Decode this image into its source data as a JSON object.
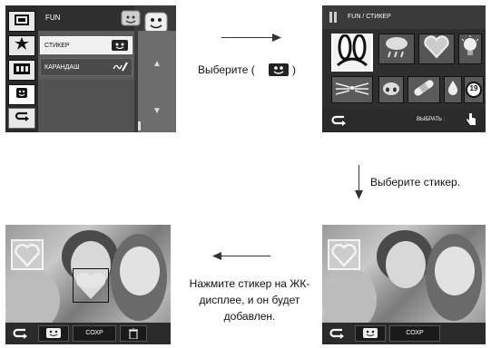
{
  "screen_menu": {
    "header": "FUN",
    "items": [
      {
        "label": "СТИКЕР",
        "icon": "sticker-icon"
      },
      {
        "label": "КАРАНДАШ",
        "icon": "pencil-icon"
      }
    ],
    "left_tabs": [
      "frame-icon",
      "star-icon",
      "film-icon",
      "smiley-icon",
      "back-icon"
    ],
    "side_arrows": [
      "▲",
      "▼"
    ]
  },
  "screen_stickers": {
    "header": "FUN / СТИКЕР",
    "stickers": [
      "bunny-ears-icon",
      "cloud-rain-icon",
      "heart-icon",
      "bulb-icon",
      "whiskers-icon",
      "nose-icon",
      "bandage-icon",
      "drop-icon",
      "number-19-icon"
    ],
    "number_label": "19",
    "footer_select": "ВЫБРАТЬ :"
  },
  "caption_step1": "Выберите (",
  "caption_step1_end": ")",
  "caption_step2": "Выберите стикер.",
  "caption_step3": [
    "Нажмите стикер на ЖК-",
    "дисплее, и он будет",
    "добавлен."
  ],
  "photo_bar": {
    "save_label": "СОХР"
  }
}
